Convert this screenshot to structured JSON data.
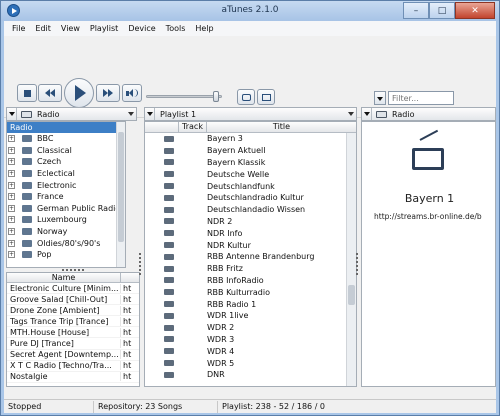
{
  "window": {
    "title": "aTunes 2.1.0",
    "min_label": "–",
    "max_label": "□",
    "close_label": "✕"
  },
  "menu": [
    "File",
    "Edit",
    "View",
    "Playlist",
    "Device",
    "Tools",
    "Help"
  ],
  "toolbar": {
    "icons": [
      "stop-icon",
      "previous-icon",
      "play-icon",
      "next-icon",
      "volume-icon",
      "repeat-icon",
      "shuffle-icon"
    ],
    "volume": 0.92,
    "filter_placeholder": "Filter..."
  },
  "navigator": {
    "selector_label": "Radio",
    "root_label": "Radio",
    "folders": [
      "BBC",
      "Classical",
      "Czech",
      "Eclectical",
      "Electronic",
      "France",
      "German Public Radio",
      "Luxembourg",
      "Norway",
      "Oldies/80's/90's",
      "Pop"
    ]
  },
  "station_list": {
    "column": "Name",
    "rows": [
      [
        "Electronic Culture [Minim...",
        "ht"
      ],
      [
        "Groove Salad [Chill-Out]",
        "ht"
      ],
      [
        "Drone Zone [Ambient]",
        "ht"
      ],
      [
        "Tags Trance Trip [Trance]",
        "ht"
      ],
      [
        "MTH.House [House]",
        "ht"
      ],
      [
        "Pure DJ [Trance]",
        "ht"
      ],
      [
        "Secret Agent [Downtemp...",
        "ht"
      ],
      [
        "X T C Radio [Techno/Tra...",
        "ht"
      ],
      [
        "Nostalgie",
        "ht"
      ]
    ]
  },
  "playlist": {
    "selector_label": "Playlist 1",
    "columns": [
      "Track",
      "Title"
    ],
    "rows": [
      "Bayern 3",
      "Bayern Aktuell",
      "Bayern Klassik",
      "Deutsche Welle",
      "Deutschlandfunk",
      "Deutschlandradio Kultur",
      "Deutschlandadio Wissen",
      "NDR 2",
      "NDR Info",
      "NDR Kultur",
      "RBB Antenne Brandenburg",
      "RBB Fritz",
      "RBB InfoRadio",
      "RBB Kulturradio",
      "RBB Radio 1",
      "WDR 1live",
      "WDR 2",
      "WDR 3",
      "WDR 4",
      "WDR 5",
      "DNR"
    ]
  },
  "context": {
    "selector_label": "Radio",
    "station_name": "Bayern 1",
    "station_url": "http://streams.br-online.de/b"
  },
  "status": {
    "state": "Stopped",
    "repository": "Repository: 23 Songs",
    "playlist": "Playlist: 238 - 52 / 186 / 0"
  }
}
